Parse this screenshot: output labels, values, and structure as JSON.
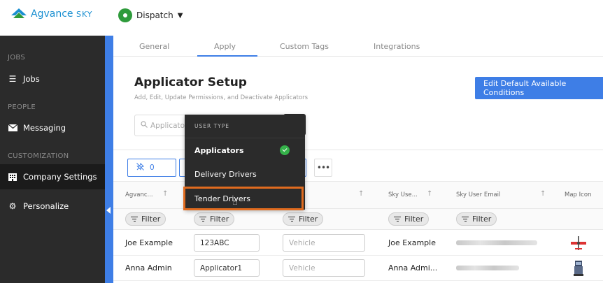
{
  "app": {
    "brand": "Agvance",
    "brand_suffix": "SKY",
    "module": "Dispatch"
  },
  "sidebar": {
    "sections": [
      {
        "header": "JOBS",
        "items": [
          {
            "label": "Jobs",
            "icon": "list-icon"
          }
        ]
      },
      {
        "header": "PEOPLE",
        "items": [
          {
            "label": "Messaging",
            "icon": "envelope-icon"
          }
        ]
      },
      {
        "header": "CUSTOMIZATION",
        "items": [
          {
            "label": "Company Settings",
            "icon": "building-icon",
            "active": true
          },
          {
            "label": "Personalize",
            "icon": "gear-icon"
          }
        ]
      }
    ]
  },
  "tabs": [
    "General",
    "Apply",
    "Custom Tags",
    "Integrations"
  ],
  "active_tab": "Apply",
  "page": {
    "title": "Applicator Setup",
    "subtitle": "Add, Edit, Update Permissions, and Deactivate Applicators",
    "edit_button": "Edit Default Available Conditions",
    "search_placeholder": "Applicato",
    "pin_count": "0"
  },
  "table": {
    "columns": [
      "Agvanc...",
      "",
      "",
      "Sky Use...",
      "Sky User Email",
      "Map Icon"
    ],
    "filter_label": "Filter",
    "vehicle_placeholder": "Vehicle",
    "rows": [
      {
        "name": "Joe Example",
        "code": "123ABC",
        "sky_user": "Joe Example"
      },
      {
        "name": "Anna Admin",
        "code": "Applicator1",
        "sky_user": "Anna Admi..."
      }
    ]
  },
  "dropdown": {
    "header": "USER TYPE",
    "options": [
      "Applicators",
      "Delivery Drivers",
      "Tender Drivers"
    ],
    "selected": "Applicators",
    "hovered": "Tender Drivers"
  },
  "colors": {
    "accent": "#3e7ee6",
    "sidebar_bg": "#2b2b2b",
    "highlight": "#e06b1f",
    "check": "#35b24a"
  }
}
